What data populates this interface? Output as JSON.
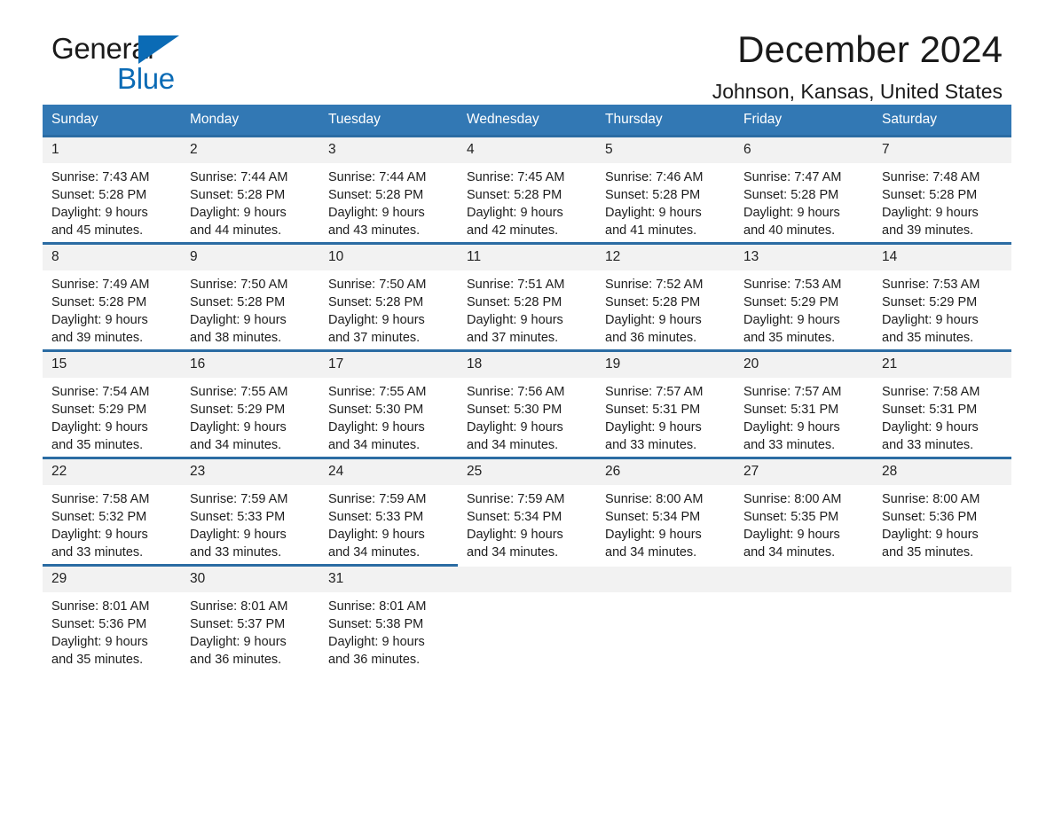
{
  "brand": {
    "name_part1": "General",
    "name_part2": "Blue",
    "triangle_color": "#0b6bb5"
  },
  "header": {
    "title": "December 2024",
    "subtitle": "Johnson, Kansas, United States"
  },
  "colors": {
    "header_bar": "#3278b4",
    "row_divider": "#2b6ca3",
    "daynum_band": "#f2f2f2",
    "brand_blue": "#0b6bb5",
    "text": "#1a1a1a"
  },
  "weekday_headers": [
    "Sunday",
    "Monday",
    "Tuesday",
    "Wednesday",
    "Thursday",
    "Friday",
    "Saturday"
  ],
  "weeks": [
    [
      {
        "day": "1",
        "sunrise": "Sunrise: 7:43 AM",
        "sunset": "Sunset: 5:28 PM",
        "daylight1": "Daylight: 9 hours",
        "daylight2": "and 45 minutes."
      },
      {
        "day": "2",
        "sunrise": "Sunrise: 7:44 AM",
        "sunset": "Sunset: 5:28 PM",
        "daylight1": "Daylight: 9 hours",
        "daylight2": "and 44 minutes."
      },
      {
        "day": "3",
        "sunrise": "Sunrise: 7:44 AM",
        "sunset": "Sunset: 5:28 PM",
        "daylight1": "Daylight: 9 hours",
        "daylight2": "and 43 minutes."
      },
      {
        "day": "4",
        "sunrise": "Sunrise: 7:45 AM",
        "sunset": "Sunset: 5:28 PM",
        "daylight1": "Daylight: 9 hours",
        "daylight2": "and 42 minutes."
      },
      {
        "day": "5",
        "sunrise": "Sunrise: 7:46 AM",
        "sunset": "Sunset: 5:28 PM",
        "daylight1": "Daylight: 9 hours",
        "daylight2": "and 41 minutes."
      },
      {
        "day": "6",
        "sunrise": "Sunrise: 7:47 AM",
        "sunset": "Sunset: 5:28 PM",
        "daylight1": "Daylight: 9 hours",
        "daylight2": "and 40 minutes."
      },
      {
        "day": "7",
        "sunrise": "Sunrise: 7:48 AM",
        "sunset": "Sunset: 5:28 PM",
        "daylight1": "Daylight: 9 hours",
        "daylight2": "and 39 minutes."
      }
    ],
    [
      {
        "day": "8",
        "sunrise": "Sunrise: 7:49 AM",
        "sunset": "Sunset: 5:28 PM",
        "daylight1": "Daylight: 9 hours",
        "daylight2": "and 39 minutes."
      },
      {
        "day": "9",
        "sunrise": "Sunrise: 7:50 AM",
        "sunset": "Sunset: 5:28 PM",
        "daylight1": "Daylight: 9 hours",
        "daylight2": "and 38 minutes."
      },
      {
        "day": "10",
        "sunrise": "Sunrise: 7:50 AM",
        "sunset": "Sunset: 5:28 PM",
        "daylight1": "Daylight: 9 hours",
        "daylight2": "and 37 minutes."
      },
      {
        "day": "11",
        "sunrise": "Sunrise: 7:51 AM",
        "sunset": "Sunset: 5:28 PM",
        "daylight1": "Daylight: 9 hours",
        "daylight2": "and 37 minutes."
      },
      {
        "day": "12",
        "sunrise": "Sunrise: 7:52 AM",
        "sunset": "Sunset: 5:28 PM",
        "daylight1": "Daylight: 9 hours",
        "daylight2": "and 36 minutes."
      },
      {
        "day": "13",
        "sunrise": "Sunrise: 7:53 AM",
        "sunset": "Sunset: 5:29 PM",
        "daylight1": "Daylight: 9 hours",
        "daylight2": "and 35 minutes."
      },
      {
        "day": "14",
        "sunrise": "Sunrise: 7:53 AM",
        "sunset": "Sunset: 5:29 PM",
        "daylight1": "Daylight: 9 hours",
        "daylight2": "and 35 minutes."
      }
    ],
    [
      {
        "day": "15",
        "sunrise": "Sunrise: 7:54 AM",
        "sunset": "Sunset: 5:29 PM",
        "daylight1": "Daylight: 9 hours",
        "daylight2": "and 35 minutes."
      },
      {
        "day": "16",
        "sunrise": "Sunrise: 7:55 AM",
        "sunset": "Sunset: 5:29 PM",
        "daylight1": "Daylight: 9 hours",
        "daylight2": "and 34 minutes."
      },
      {
        "day": "17",
        "sunrise": "Sunrise: 7:55 AM",
        "sunset": "Sunset: 5:30 PM",
        "daylight1": "Daylight: 9 hours",
        "daylight2": "and 34 minutes."
      },
      {
        "day": "18",
        "sunrise": "Sunrise: 7:56 AM",
        "sunset": "Sunset: 5:30 PM",
        "daylight1": "Daylight: 9 hours",
        "daylight2": "and 34 minutes."
      },
      {
        "day": "19",
        "sunrise": "Sunrise: 7:57 AM",
        "sunset": "Sunset: 5:31 PM",
        "daylight1": "Daylight: 9 hours",
        "daylight2": "and 33 minutes."
      },
      {
        "day": "20",
        "sunrise": "Sunrise: 7:57 AM",
        "sunset": "Sunset: 5:31 PM",
        "daylight1": "Daylight: 9 hours",
        "daylight2": "and 33 minutes."
      },
      {
        "day": "21",
        "sunrise": "Sunrise: 7:58 AM",
        "sunset": "Sunset: 5:31 PM",
        "daylight1": "Daylight: 9 hours",
        "daylight2": "and 33 minutes."
      }
    ],
    [
      {
        "day": "22",
        "sunrise": "Sunrise: 7:58 AM",
        "sunset": "Sunset: 5:32 PM",
        "daylight1": "Daylight: 9 hours",
        "daylight2": "and 33 minutes."
      },
      {
        "day": "23",
        "sunrise": "Sunrise: 7:59 AM",
        "sunset": "Sunset: 5:33 PM",
        "daylight1": "Daylight: 9 hours",
        "daylight2": "and 33 minutes."
      },
      {
        "day": "24",
        "sunrise": "Sunrise: 7:59 AM",
        "sunset": "Sunset: 5:33 PM",
        "daylight1": "Daylight: 9 hours",
        "daylight2": "and 34 minutes."
      },
      {
        "day": "25",
        "sunrise": "Sunrise: 7:59 AM",
        "sunset": "Sunset: 5:34 PM",
        "daylight1": "Daylight: 9 hours",
        "daylight2": "and 34 minutes."
      },
      {
        "day": "26",
        "sunrise": "Sunrise: 8:00 AM",
        "sunset": "Sunset: 5:34 PM",
        "daylight1": "Daylight: 9 hours",
        "daylight2": "and 34 minutes."
      },
      {
        "day": "27",
        "sunrise": "Sunrise: 8:00 AM",
        "sunset": "Sunset: 5:35 PM",
        "daylight1": "Daylight: 9 hours",
        "daylight2": "and 34 minutes."
      },
      {
        "day": "28",
        "sunrise": "Sunrise: 8:00 AM",
        "sunset": "Sunset: 5:36 PM",
        "daylight1": "Daylight: 9 hours",
        "daylight2": "and 35 minutes."
      }
    ],
    [
      {
        "day": "29",
        "sunrise": "Sunrise: 8:01 AM",
        "sunset": "Sunset: 5:36 PM",
        "daylight1": "Daylight: 9 hours",
        "daylight2": "and 35 minutes."
      },
      {
        "day": "30",
        "sunrise": "Sunrise: 8:01 AM",
        "sunset": "Sunset: 5:37 PM",
        "daylight1": "Daylight: 9 hours",
        "daylight2": "and 36 minutes."
      },
      {
        "day": "31",
        "sunrise": "Sunrise: 8:01 AM",
        "sunset": "Sunset: 5:38 PM",
        "daylight1": "Daylight: 9 hours",
        "daylight2": "and 36 minutes."
      },
      {
        "day": "",
        "sunrise": "",
        "sunset": "",
        "daylight1": "",
        "daylight2": "",
        "blank": true
      },
      {
        "day": "",
        "sunrise": "",
        "sunset": "",
        "daylight1": "",
        "daylight2": "",
        "blank": true
      },
      {
        "day": "",
        "sunrise": "",
        "sunset": "",
        "daylight1": "",
        "daylight2": "",
        "blank": true
      },
      {
        "day": "",
        "sunrise": "",
        "sunset": "",
        "daylight1": "",
        "daylight2": "",
        "blank": true
      }
    ]
  ]
}
